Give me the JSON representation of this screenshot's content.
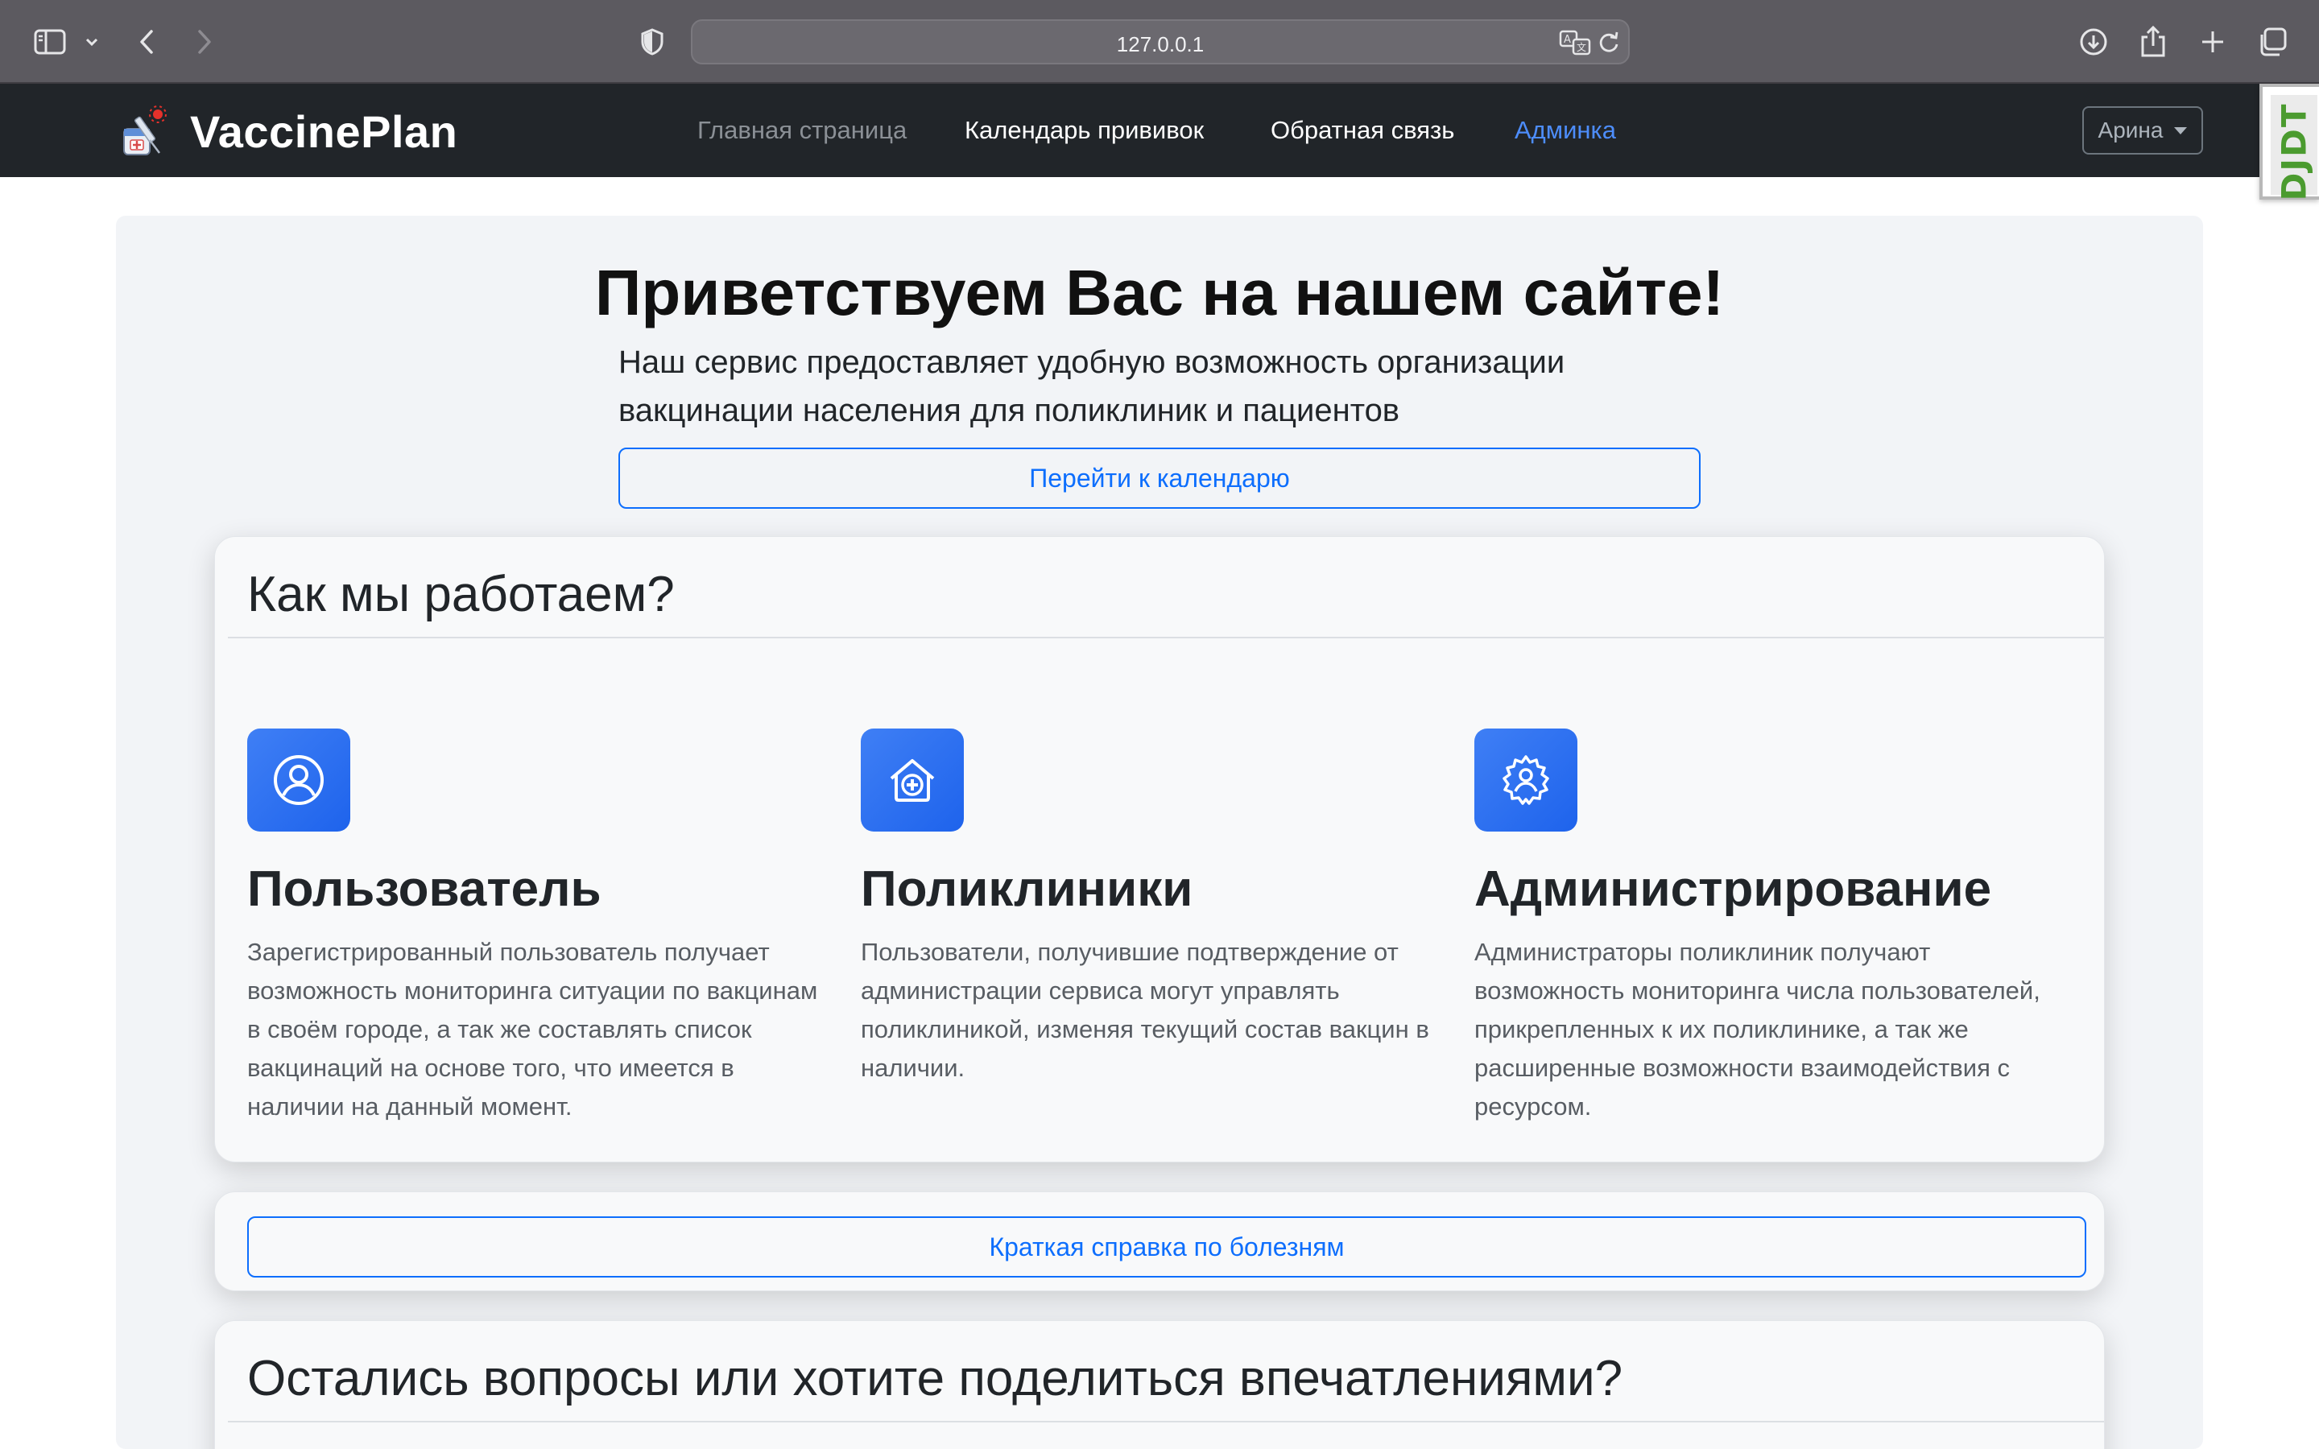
{
  "browser": {
    "url": "127.0.0.1",
    "icons": [
      "sidebar-icon",
      "chevron-down-icon",
      "back-icon",
      "forward-icon",
      "shield-icon",
      "translate-icon",
      "reload-icon",
      "download-icon",
      "share-icon",
      "new-tab-icon",
      "tabs-overview-icon"
    ]
  },
  "navbar": {
    "brand": "VaccinePlan",
    "links": {
      "home": "Главная страница",
      "calendar": "Календарь прививок",
      "feedback": "Обратная связь",
      "admin": "Админка"
    },
    "user": "Арина",
    "debug_toolbar": "DJDT"
  },
  "hero": {
    "title": "Приветствуем Вас на нашем сайте!",
    "lead": "Наш сервис предоставляет удобную возможность организации вакцинации населения для поликлиник и пациентов",
    "calendar_button": "Перейти к календарю"
  },
  "how_we_work": {
    "title": "Как мы работаем?",
    "features": [
      {
        "icon": "user-circle-icon",
        "title": "Пользователь",
        "text": "Зарегистрированный пользователь получает возможность мониторинга ситуации по вакцинам в своём городе, а так же составлять список вакцинаций на основе того, что имеется в наличии на данный момент."
      },
      {
        "icon": "hospital-house-icon",
        "title": "Поликлиники",
        "text": "Пользователи, получившие подтверждение от администрации сервиса могут управлять поликлиникой, изменяя текущий состав вакцин в наличии."
      },
      {
        "icon": "gear-user-icon",
        "title": "Администрирование",
        "text": "Администраторы поликлиник получают возможность мониторинга числа пользователей, прикрепленных к их поликлинике, а так же расширенные возможности взаимодействия с ресурсом."
      }
    ]
  },
  "diseases": {
    "button": "Краткая справка по болезням"
  },
  "questions": {
    "title": "Остались вопросы или хотите поделиться впечатлениями?"
  },
  "colors": {
    "navbar_bg": "#212529",
    "accent": "#0d6efd",
    "icon_bg": "#2f73f2",
    "page_panel": "#f2f4f7"
  }
}
